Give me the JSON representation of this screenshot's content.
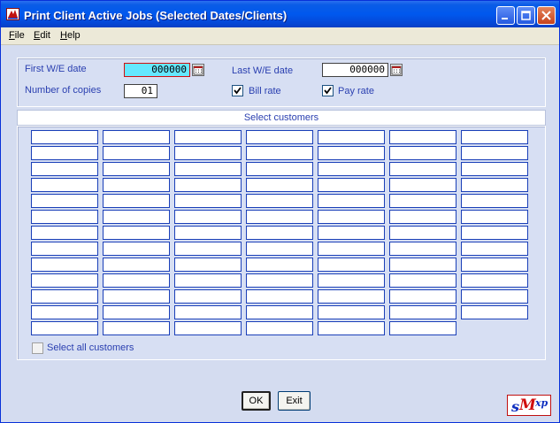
{
  "window": {
    "title": "Print Client Active Jobs (Selected Dates/Clients)",
    "minimize_icon": "minimize-icon",
    "maximize_icon": "maximize-icon",
    "close_icon": "close-icon"
  },
  "menu": {
    "file": {
      "hotkey": "F",
      "rest": "ile"
    },
    "edit": {
      "hotkey": "E",
      "rest": "dit"
    },
    "help": {
      "hotkey": "H",
      "rest": "elp"
    }
  },
  "form": {
    "first_we_label": "First W/E date",
    "first_we_value": "000000",
    "last_we_label": "Last W/E date",
    "last_we_value": "000000",
    "copies_label": "Number of copies",
    "copies_value": "01",
    "bill_rate_label": "Bill rate",
    "bill_rate_checked": true,
    "pay_rate_label": "Pay rate",
    "pay_rate_checked": true
  },
  "customers": {
    "header": "Select customers",
    "column_counts": [
      13,
      13,
      13,
      13,
      13,
      13,
      12
    ],
    "select_all_label": "Select all customers",
    "select_all_checked": false
  },
  "buttons": {
    "ok": "OK",
    "exit": "Exit"
  },
  "logo": {
    "s": "s",
    "m": "M",
    "xp": "xp"
  },
  "colors": {
    "active_field": "#66e8ff",
    "label_text": "#2a3fb0",
    "window_bg": "#d4dcf0"
  }
}
